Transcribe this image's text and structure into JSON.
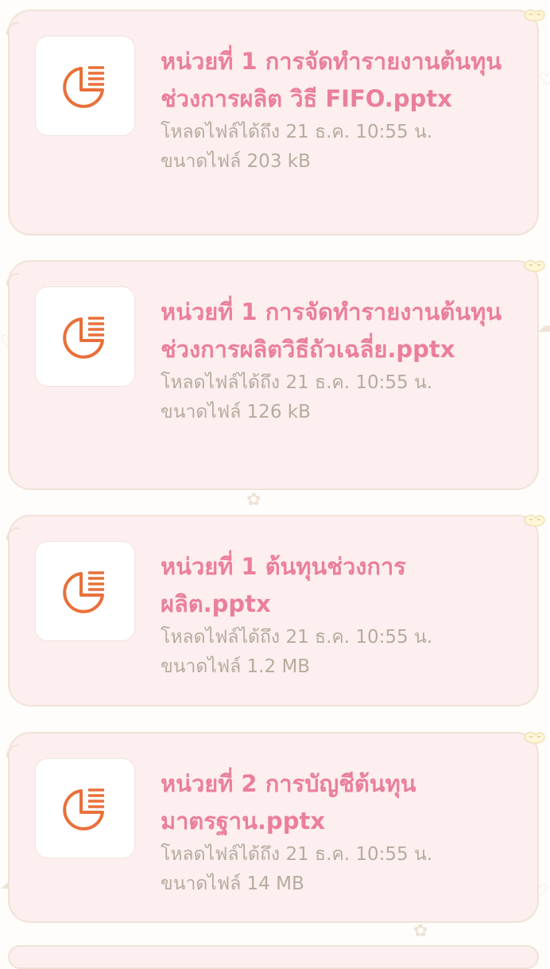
{
  "files": [
    {
      "name": "หน่วยที่ 1 การจัดทำรายงานต้นทุนช่วงการผลิต วิธี FIFO.pptx",
      "expiry": "โหลดไฟล์ได้ถึง 21 ธ.ค. 10:55 น.",
      "size": "ขนาดไฟล์ 203 kB",
      "icon": "presentation-file-icon"
    },
    {
      "name": "หน่วยที่ 1 การจัดทำรายงานต้นทุนช่วงการผลิตวิธีถัวเฉลี่ย.pptx",
      "expiry": "โหลดไฟล์ได้ถึง 21 ธ.ค. 10:55 น.",
      "size": "ขนาดไฟล์ 126 kB",
      "icon": "presentation-file-icon"
    },
    {
      "name": "หน่วยที่ 1 ต้นทุนช่วงการผลิต.pptx",
      "expiry": "โหลดไฟล์ได้ถึง 21 ธ.ค. 10:55 น.",
      "size": "ขนาดไฟล์ 1.2 MB",
      "icon": "presentation-file-icon"
    },
    {
      "name": "หน่วยที่ 2 การบัญชีต้นทุนมาตรฐาน.pptx",
      "expiry": "โหลดไฟล์ได้ถึง 21 ธ.ค. 10:55 น.",
      "size": "ขนาดไฟล์ 14 MB",
      "icon": "presentation-file-icon"
    }
  ],
  "colors": {
    "bubble_bg": "#fdeef0",
    "bubble_border": "#efe3d6",
    "file_name": "#ea7f9b",
    "meta_text": "#b7ab9c",
    "icon_accent": "#e8703a"
  }
}
